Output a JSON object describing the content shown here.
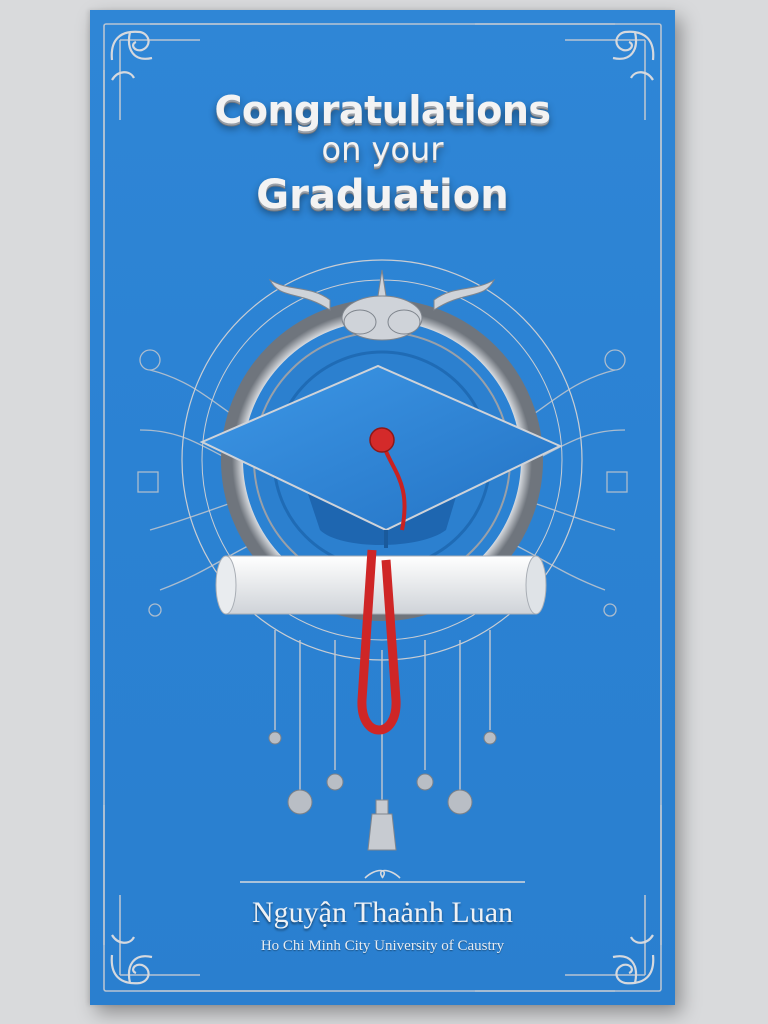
{
  "card": {
    "title_line1": "Congratulations",
    "title_line2": "on your",
    "title_line3": "Graduation",
    "name": "Nguyận Thaȧnh Luan",
    "university": "Ho Chi Minh City University of Caustry"
  },
  "colors": {
    "card_blue": "#2b82d3",
    "silver": "#c9ccd1",
    "tassel_red": "#d42a2a",
    "scroll_white": "#f4f4f4"
  },
  "icons": [
    "graduation-cap-icon",
    "diploma-scroll-icon",
    "tassel-icon",
    "ornament-flourish-icon"
  ]
}
